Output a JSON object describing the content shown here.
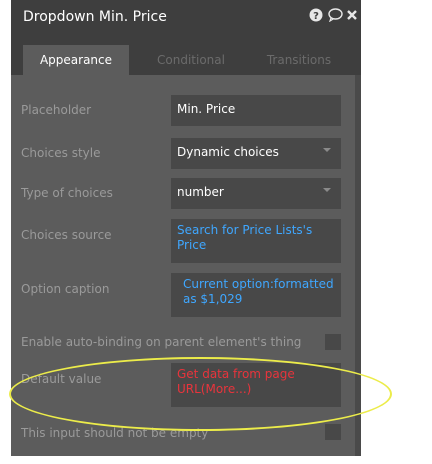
{
  "header": {
    "title": "Dropdown Min. Price",
    "icons": [
      "help-icon",
      "comment-icon",
      "close-icon"
    ]
  },
  "tabs": [
    {
      "label": "Appearance",
      "active": true
    },
    {
      "label": "Conditional",
      "active": false
    },
    {
      "label": "Transitions",
      "active": false
    }
  ],
  "properties": {
    "placeholder": {
      "label": "Placeholder",
      "value": "Min. Price"
    },
    "choices_style": {
      "label": "Choices style",
      "value": "Dynamic choices"
    },
    "type_of_choices": {
      "label": "Type of choices",
      "value": "number"
    },
    "choices_source": {
      "label": "Choices source",
      "value": "Search for Price Lists's Price"
    },
    "option_caption": {
      "label": "Option caption",
      "value": "Current option:formatted as $1,029"
    },
    "auto_binding": {
      "label": "Enable auto-binding on parent element's thing",
      "checked": false
    },
    "default_value": {
      "label": "Default value",
      "value": "Get data from page URL(More...)"
    },
    "not_empty": {
      "label": "This input should not be empty",
      "checked": false
    }
  },
  "colors": {
    "panel": "#5c5c5c",
    "header": "#3e3e3e",
    "dynamic_link": "#3fa7ff",
    "error_text": "#e8343c",
    "highlight": "#ecec4a"
  }
}
